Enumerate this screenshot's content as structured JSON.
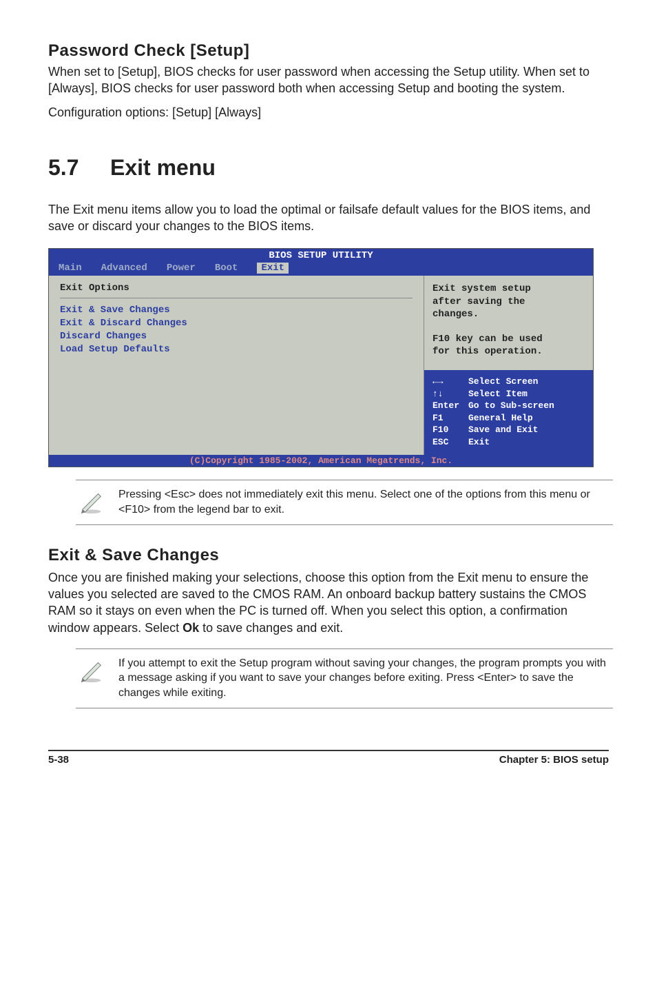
{
  "heading1": "Password Check [Setup]",
  "p1": "When set to [Setup], BIOS checks for user password when accessing the Setup utility. When set to [Always], BIOS checks for user password both when accessing Setup and booting the system.",
  "p1b": "Configuration options: [Setup] [Always]",
  "section_num": "5.7",
  "section_title": "Exit menu",
  "section_intro": "The Exit menu items allow you to load the optimal or failsafe default values for the BIOS items, and save or discard your changes to the BIOS items.",
  "bios": {
    "title": "BIOS SETUP UTILITY",
    "tabs": [
      "Main",
      "Advanced",
      "Power",
      "Boot",
      "Exit"
    ],
    "active_tab": "Exit",
    "left_title": "Exit Options",
    "options": [
      "Exit & Save Changes",
      "Exit & Discard Changes",
      "Discard Changes",
      "",
      "Load Setup Defaults"
    ],
    "help_top_lines": [
      "Exit system setup",
      "after saving the",
      "changes.",
      "",
      "F10 key can be used",
      "for this operation."
    ],
    "keyhelp": [
      {
        "k": "←→",
        "v": "Select Screen"
      },
      {
        "k": "↑↓",
        "v": "Select Item"
      },
      {
        "k": "Enter",
        "v": "Go to Sub-screen"
      },
      {
        "k": "F1",
        "v": "General Help"
      },
      {
        "k": "F10",
        "v": "Save and Exit"
      },
      {
        "k": "ESC",
        "v": "Exit"
      }
    ],
    "copyright": "(C)Copyright 1985-2002, American Megatrends, Inc."
  },
  "note1": "Pressing <Esc> does not immediately exit this menu. Select one of the options from this menu or <F10> from the legend bar to exit.",
  "heading2": "Exit & Save Changes",
  "p2a": "Once you are finished making your selections, choose this option from the Exit menu to ensure the values you selected are saved to the CMOS RAM. An onboard backup battery sustains the CMOS RAM so it stays on even when the PC is turned off. When you select this option, a confirmation window appears. Select ",
  "p2b_bold": "Ok",
  "p2c": " to save changes and exit.",
  "note2": " If you attempt to exit the Setup program without saving your changes, the program prompts you with a message asking if you want to save your changes before exiting. Press <Enter>  to save the  changes while exiting.",
  "footer_left": "5-38",
  "footer_right": "Chapter 5: BIOS setup"
}
